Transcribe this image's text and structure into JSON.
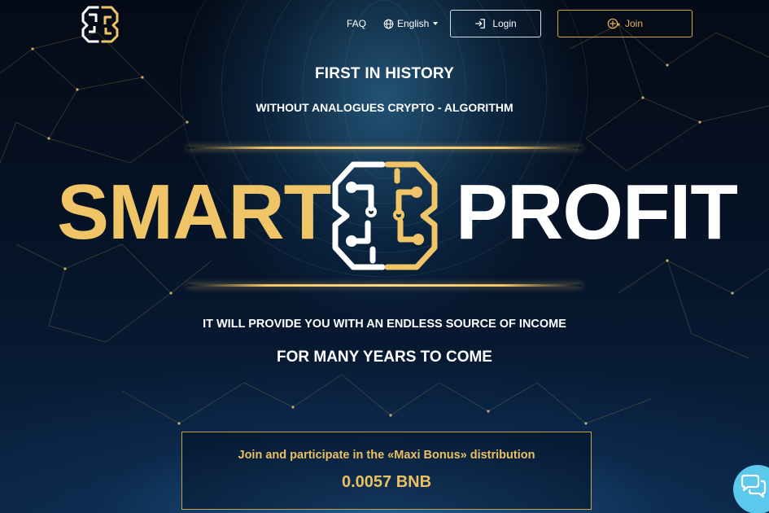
{
  "header": {
    "faq_label": "FAQ",
    "language_label": "English",
    "login_label": "Login",
    "join_label": "Join"
  },
  "hero": {
    "first_in_history": "FIRST IN HISTORY",
    "without_analogues": "WITHOUT ANALOGUES CRYPTO - ALGORITHM",
    "brand_left": "SMART",
    "brand_right": "PROFIT",
    "provide_text": "IT WILL PROVIDE YOU WITH AN ENDLESS SOURCE OF INCOME",
    "years_text": "FOR MANY YEARS TO COME"
  },
  "bonus": {
    "text": "Join and participate in the «Maxi Bonus» distribution",
    "amount": "0.0057 BNB"
  },
  "icons": {
    "logo": "brain-circuit-logo",
    "language": "globe-icon",
    "login": "login-arrow-icon",
    "join": "plus-circle-icon",
    "chat": "chat-bubbles-icon"
  },
  "colors": {
    "gold": "#efc567",
    "gold_border": "#d4a84a",
    "white": "#ffffff",
    "chat": "#5bc8ec",
    "background": "#061326"
  }
}
